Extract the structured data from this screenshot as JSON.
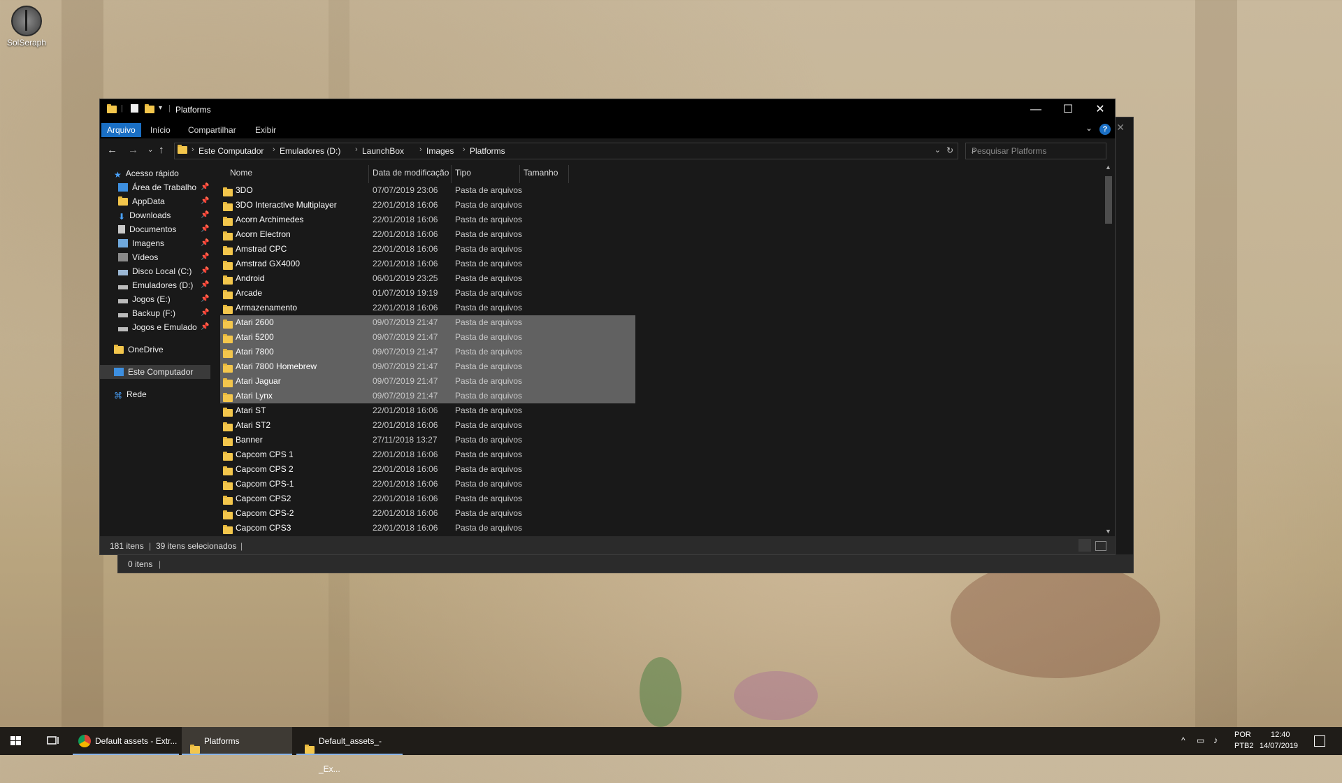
{
  "desktop": {
    "icon_label": "SolSeraph"
  },
  "window": {
    "title": "Platforms",
    "controls": {
      "minimize": "—",
      "maximize": "☐",
      "close": "✕"
    },
    "ribbon_tabs": [
      "Arquivo",
      "Início",
      "Compartilhar",
      "Exibir"
    ],
    "breadcrumb": [
      "Este Computador",
      "Emuladores (D:)",
      "LaunchBox",
      "Images",
      "Platforms"
    ],
    "search_placeholder": "Pesquisar Platforms",
    "help": "?",
    "nav_pane": [
      {
        "label": "Acesso rápido",
        "icon": "star-icon",
        "pinned": false
      },
      {
        "label": "Área de Trabalho",
        "icon": "desktop-icon",
        "pinned": true
      },
      {
        "label": "AppData",
        "icon": "folder-icon",
        "pinned": true
      },
      {
        "label": "Downloads",
        "icon": "download-icon",
        "pinned": true
      },
      {
        "label": "Documentos",
        "icon": "document-icon",
        "pinned": true
      },
      {
        "label": "Imagens",
        "icon": "image-icon",
        "pinned": true
      },
      {
        "label": "Vídeos",
        "icon": "video-icon",
        "pinned": true
      },
      {
        "label": "Disco Local (C:)",
        "icon": "drive-icon",
        "pinned": true
      },
      {
        "label": "Emuladores (D:)",
        "icon": "drive-icon",
        "pinned": true
      },
      {
        "label": "Jogos (E:)",
        "icon": "drive-icon",
        "pinned": true
      },
      {
        "label": "Backup (F:)",
        "icon": "drive-icon",
        "pinned": true
      },
      {
        "label": "Jogos e Emulado",
        "icon": "drive-icon",
        "pinned": true
      },
      {
        "label": "OneDrive",
        "icon": "cloud-icon",
        "pinned": false
      },
      {
        "label": "Este Computador",
        "icon": "computer-icon",
        "pinned": false
      },
      {
        "label": "Rede",
        "icon": "network-icon",
        "pinned": false
      }
    ],
    "columns": [
      "Nome",
      "Data de modificação",
      "Tipo",
      "Tamanho"
    ],
    "files": [
      {
        "name": "3DO",
        "date": "07/07/2019 23:06",
        "type": "Pasta de arquivos",
        "selected": false
      },
      {
        "name": "3DO Interactive Multiplayer",
        "date": "22/01/2018 16:06",
        "type": "Pasta de arquivos",
        "selected": false
      },
      {
        "name": "Acorn Archimedes",
        "date": "22/01/2018 16:06",
        "type": "Pasta de arquivos",
        "selected": false
      },
      {
        "name": "Acorn Electron",
        "date": "22/01/2018 16:06",
        "type": "Pasta de arquivos",
        "selected": false
      },
      {
        "name": "Amstrad CPC",
        "date": "22/01/2018 16:06",
        "type": "Pasta de arquivos",
        "selected": false
      },
      {
        "name": "Amstrad GX4000",
        "date": "22/01/2018 16:06",
        "type": "Pasta de arquivos",
        "selected": false
      },
      {
        "name": "Android",
        "date": "06/01/2019 23:25",
        "type": "Pasta de arquivos",
        "selected": false
      },
      {
        "name": "Arcade",
        "date": "01/07/2019 19:19",
        "type": "Pasta de arquivos",
        "selected": false
      },
      {
        "name": "Armazenamento",
        "date": "22/01/2018 16:06",
        "type": "Pasta de arquivos",
        "selected": false
      },
      {
        "name": "Atari 2600",
        "date": "09/07/2019 21:47",
        "type": "Pasta de arquivos",
        "selected": true
      },
      {
        "name": "Atari 5200",
        "date": "09/07/2019 21:47",
        "type": "Pasta de arquivos",
        "selected": true
      },
      {
        "name": "Atari 7800",
        "date": "09/07/2019 21:47",
        "type": "Pasta de arquivos",
        "selected": true
      },
      {
        "name": "Atari 7800 Homebrew",
        "date": "09/07/2019 21:47",
        "type": "Pasta de arquivos",
        "selected": true
      },
      {
        "name": "Atari Jaguar",
        "date": "09/07/2019 21:47",
        "type": "Pasta de arquivos",
        "selected": true
      },
      {
        "name": "Atari Lynx",
        "date": "09/07/2019 21:47",
        "type": "Pasta de arquivos",
        "selected": true
      },
      {
        "name": "Atari ST",
        "date": "22/01/2018 16:06",
        "type": "Pasta de arquivos",
        "selected": false
      },
      {
        "name": "Atari ST2",
        "date": "22/01/2018 16:06",
        "type": "Pasta de arquivos",
        "selected": false
      },
      {
        "name": "Banner",
        "date": "27/11/2018 13:27",
        "type": "Pasta de arquivos",
        "selected": false
      },
      {
        "name": "Capcom CPS 1",
        "date": "22/01/2018 16:06",
        "type": "Pasta de arquivos",
        "selected": false
      },
      {
        "name": "Capcom CPS 2",
        "date": "22/01/2018 16:06",
        "type": "Pasta de arquivos",
        "selected": false
      },
      {
        "name": "Capcom CPS-1",
        "date": "22/01/2018 16:06",
        "type": "Pasta de arquivos",
        "selected": false
      },
      {
        "name": "Capcom CPS2",
        "date": "22/01/2018 16:06",
        "type": "Pasta de arquivos",
        "selected": false
      },
      {
        "name": "Capcom CPS-2",
        "date": "22/01/2018 16:06",
        "type": "Pasta de arquivos",
        "selected": false
      },
      {
        "name": "Capcom CPS3",
        "date": "22/01/2018 16:06",
        "type": "Pasta de arquivos",
        "selected": false
      }
    ],
    "status": {
      "count": "181 itens",
      "separator": "|",
      "selected": "39 itens selecionados"
    }
  },
  "back_window": {
    "status": "0 itens",
    "separator": "|"
  },
  "taskbar": {
    "items": [
      {
        "label": "Default assets - Extr...",
        "icon": "chrome-icon",
        "active": false
      },
      {
        "label": "Platforms",
        "icon": "folder-icon",
        "active": true
      },
      {
        "label": "Default_assets_-_Ex...",
        "icon": "folder-icon",
        "active": false
      }
    ],
    "lang": "POR",
    "layout": "PTB2",
    "time": "12:40",
    "date": "14/07/2019"
  },
  "colors": {
    "accent": "#1a6fc4",
    "folder": "#f3c64c",
    "selection": "#616161",
    "window_bg": "#191919"
  }
}
